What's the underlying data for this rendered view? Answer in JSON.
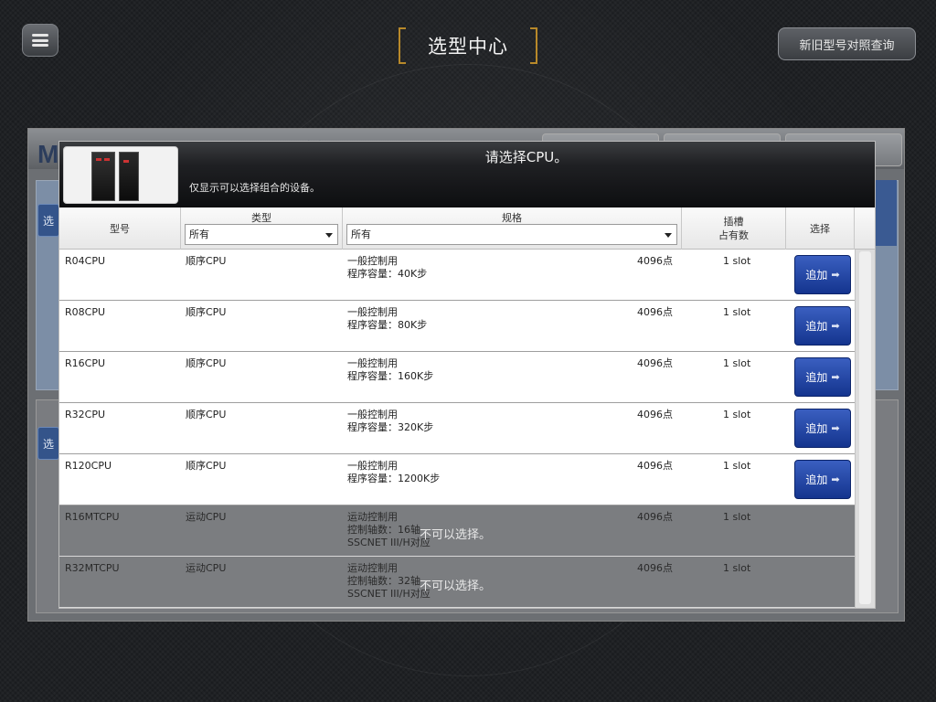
{
  "topbar": {
    "title": "选型中心",
    "compare_button": "新旧型号对照查询"
  },
  "background": {
    "logo_text": "MELSEC iQ-R 选型系统",
    "side_button_1": "选",
    "side_button_2": "选"
  },
  "modal": {
    "title": "请选择CPU。",
    "subtitle": "仅显示可以选择组合的设备。",
    "columns": {
      "model": "型号",
      "type": "类型",
      "spec": "规格",
      "slot": "插槽\n占有数",
      "select": "选择"
    },
    "filters": {
      "type_value": "所有",
      "spec_value": "所有"
    },
    "add_label": "追加",
    "unavailable_label": "不可以选择。",
    "rows": [
      {
        "model": "R04CPU",
        "type": "顺序CPU",
        "spec1": "一般控制用",
        "spec2": "程序容量：40K步",
        "spec3": "",
        "points": "4096点",
        "slot": "1 slot",
        "selectable": true
      },
      {
        "model": "R08CPU",
        "type": "顺序CPU",
        "spec1": "一般控制用",
        "spec2": "程序容量：80K步",
        "spec3": "",
        "points": "4096点",
        "slot": "1 slot",
        "selectable": true
      },
      {
        "model": "R16CPU",
        "type": "顺序CPU",
        "spec1": "一般控制用",
        "spec2": "程序容量：160K步",
        "spec3": "",
        "points": "4096点",
        "slot": "1 slot",
        "selectable": true
      },
      {
        "model": "R32CPU",
        "type": "顺序CPU",
        "spec1": "一般控制用",
        "spec2": "程序容量：320K步",
        "spec3": "",
        "points": "4096点",
        "slot": "1 slot",
        "selectable": true
      },
      {
        "model": "R120CPU",
        "type": "顺序CPU",
        "spec1": "一般控制用",
        "spec2": "程序容量：1200K步",
        "spec3": "",
        "points": "4096点",
        "slot": "1 slot",
        "selectable": true
      },
      {
        "model": "R16MTCPU",
        "type": "运动CPU",
        "spec1": "运动控制用",
        "spec2": "控制轴数：16轴",
        "spec3": "SSCNET III/H对应",
        "points": "4096点",
        "slot": "1 slot",
        "selectable": false
      },
      {
        "model": "R32MTCPU",
        "type": "运动CPU",
        "spec1": "运动控制用",
        "spec2": "控制轴数：32轴",
        "spec3": "SSCNET III/H对应",
        "points": "4096点",
        "slot": "1 slot",
        "selectable": false
      }
    ]
  }
}
